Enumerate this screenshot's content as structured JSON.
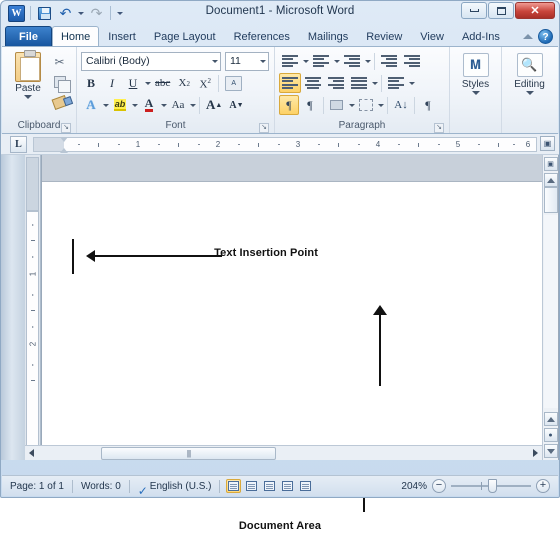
{
  "window": {
    "title": "Document1  -  Microsoft Word",
    "controls": {
      "minimize": "minimize-icon",
      "maximize": "maximize-icon",
      "close": "✕"
    }
  },
  "quick_access": {
    "app_logo": "W",
    "items": [
      {
        "name": "save",
        "icon": "save-icon"
      },
      {
        "name": "undo",
        "icon": "undo-icon"
      },
      {
        "name": "redo",
        "icon": "redo-icon"
      },
      {
        "name": "customize-quick-access-toolbar",
        "icon": "chevron-down-icon"
      }
    ]
  },
  "ribbon": {
    "tabs": [
      {
        "label": "File",
        "active": false,
        "kind": "file"
      },
      {
        "label": "Home",
        "active": true
      },
      {
        "label": "Insert",
        "active": false
      },
      {
        "label": "Page Layout",
        "active": false
      },
      {
        "label": "References",
        "active": false
      },
      {
        "label": "Mailings",
        "active": false
      },
      {
        "label": "Review",
        "active": false
      },
      {
        "label": "View",
        "active": false
      },
      {
        "label": "Add-Ins",
        "active": false
      }
    ],
    "minimize_ribbon": "chevron-up-icon",
    "help": "?",
    "groups": {
      "clipboard": {
        "label": "Clipboard",
        "paste": "Paste",
        "cut": "✂",
        "copy": "copy-icon",
        "format_painter": "format-painter-icon",
        "dialog_launcher": "↘"
      },
      "font": {
        "label": "Font",
        "font_name": "Calibri (Body)",
        "font_size": "11",
        "bold": "B",
        "italic": "I",
        "underline": "U",
        "strikethrough": "abc",
        "subscript": "X",
        "subscript_idx": "2",
        "superscript": "X",
        "superscript_idx": "2",
        "clear_formatting": "clear-formatting-icon",
        "text_effects": "A",
        "highlight": "ab",
        "font_color": "A",
        "change_case": "Aa",
        "grow_font": "A",
        "shrink_font": "A",
        "dialog_launcher": "↘"
      },
      "paragraph": {
        "label": "Paragraph",
        "bullets": "bullets-icon",
        "numbering": "numbering-icon",
        "multilevel_list": "multilevel-list-icon",
        "decrease_indent": "decrease-indent-icon",
        "increase_indent": "increase-indent-icon",
        "align_left": "align-left-icon",
        "align_center": "align-center-icon",
        "align_right": "align-right-icon",
        "justify": "justify-icon",
        "line_spacing": "line-spacing-icon",
        "ltr": "¶",
        "rtl": "¶",
        "shading": "shading-icon",
        "borders": "borders-icon",
        "sort": "sort-icon",
        "show_marks": "¶",
        "dialog_launcher": "↘"
      },
      "styles": {
        "label": "Styles",
        "icon": "styles-icon"
      },
      "editing": {
        "label": "Editing",
        "icon": "binoculars-icon"
      }
    }
  },
  "ruler": {
    "tab_selector": "L",
    "horizontal_numbers": [
      "1",
      "2",
      "3",
      "4",
      "5",
      "6"
    ],
    "vertical_numbers": [
      "1",
      "2"
    ],
    "view_ruler_button": "view-ruler-icon"
  },
  "document": {
    "page_background": "#ffffff",
    "annotations": [
      {
        "name": "text-insertion-point",
        "label": "Text Insertion Point"
      },
      {
        "name": "document-area",
        "label": "Document Area"
      }
    ]
  },
  "scrollbars": {
    "vertical": {
      "select_browse_object": "browse-object-icon",
      "previous_page": "previous-page-icon",
      "next_page": "next-page-icon",
      "scroll_up": "scroll-up-icon",
      "scroll_down": "scroll-down-icon"
    },
    "horizontal": {
      "scroll_left": "scroll-left-icon",
      "scroll_right": "scroll-right-icon",
      "thumb": "||||"
    }
  },
  "status_bar": {
    "page": "Page: 1 of 1",
    "words": "Words: 0",
    "proofing": "proofing-errors-icon",
    "language": "English (U.S.)",
    "views": [
      {
        "name": "print-layout",
        "active": true
      },
      {
        "name": "full-screen-reading",
        "active": false
      },
      {
        "name": "web-layout",
        "active": false
      },
      {
        "name": "outline",
        "active": false
      },
      {
        "name": "draft",
        "active": false
      }
    ],
    "zoom_level": "204%",
    "zoom_out": "−",
    "zoom_in": "+"
  },
  "colors": {
    "file_tab": "#18569f",
    "close_button": "#c9453c",
    "accent_highlight": "#fdd166",
    "workspace": "#8fa2b6",
    "annotation": "#111111"
  }
}
